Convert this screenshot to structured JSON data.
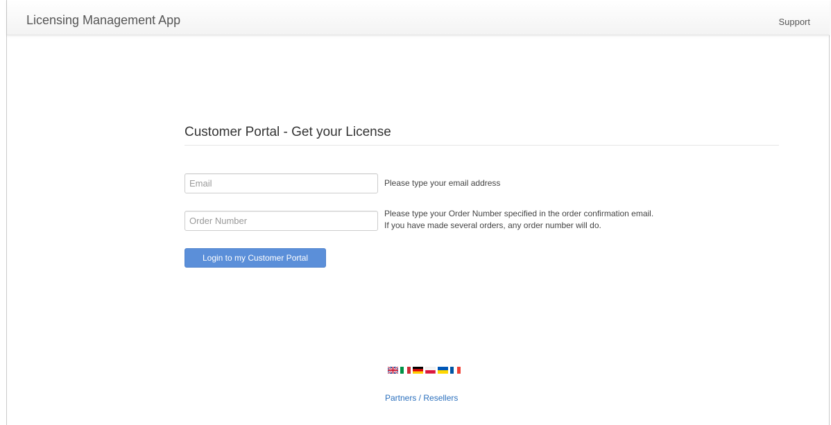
{
  "navbar": {
    "brand": "Licensing Management App",
    "support_label": "Support"
  },
  "main": {
    "title": "Customer Portal - Get your License",
    "email": {
      "placeholder": "Email",
      "value": "",
      "help": "Please type your email address"
    },
    "order": {
      "placeholder": "Order Number",
      "value": "",
      "help_line1": "Please type your Order Number specified in the order confirmation email.",
      "help_line2": "If you have made several orders, any order number will do."
    },
    "login_label": "Login to my Customer Portal"
  },
  "footer": {
    "flags": [
      {
        "name": "uk-flag-icon"
      },
      {
        "name": "italy-flag-icon"
      },
      {
        "name": "germany-flag-icon"
      },
      {
        "name": "poland-flag-icon"
      },
      {
        "name": "ukraine-flag-icon"
      },
      {
        "name": "france-flag-icon"
      }
    ],
    "partners_label": "Partners / Resellers"
  },
  "colors": {
    "accent": "#5b8fd9",
    "link": "#2a6fbd"
  }
}
